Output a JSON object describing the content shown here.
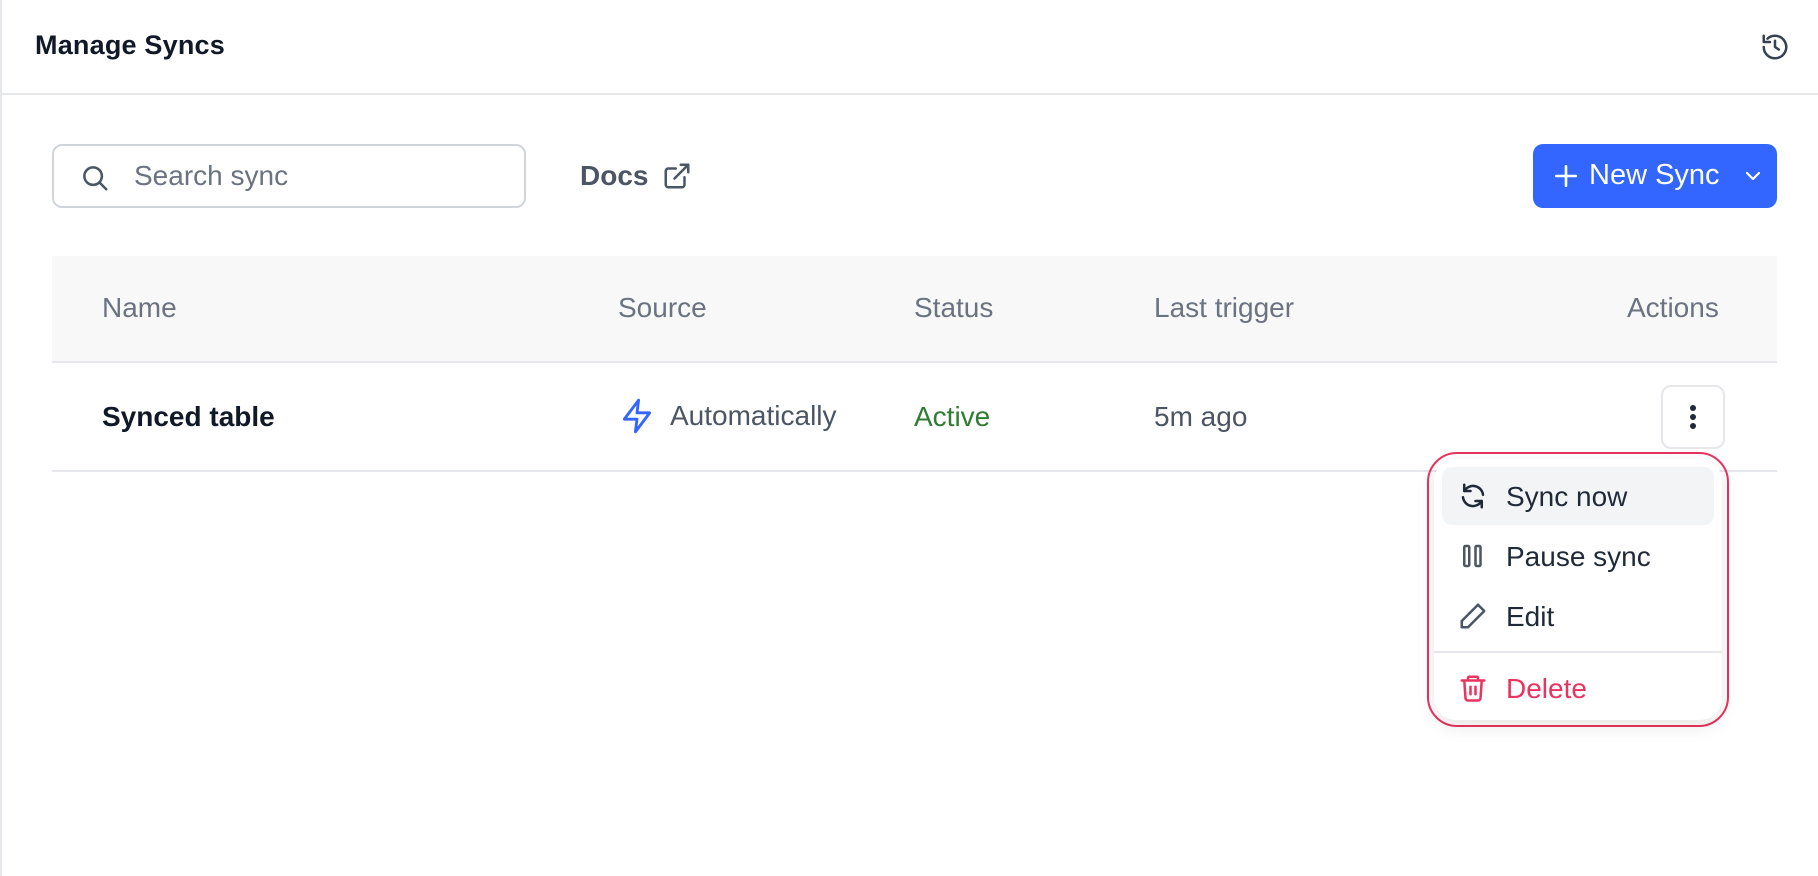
{
  "header": {
    "title": "Manage Syncs",
    "history_icon": "history-icon"
  },
  "toolbar": {
    "search_placeholder": "Search sync",
    "search_value": "",
    "docs_label": "Docs",
    "new_sync_label": "New Sync"
  },
  "table": {
    "columns": [
      "Name",
      "Source",
      "Status",
      "Last trigger",
      "Actions"
    ],
    "rows": [
      {
        "name": "Synced table",
        "source": "Automatically",
        "source_icon": "lightning-icon",
        "status": "Active",
        "last_trigger": "5m ago"
      }
    ]
  },
  "action_menu": {
    "items": [
      {
        "label": "Sync now",
        "icon": "refresh-icon",
        "active": true
      },
      {
        "label": "Pause sync",
        "icon": "pause-icon"
      },
      {
        "label": "Edit",
        "icon": "pencil-icon"
      },
      {
        "label": "Delete",
        "icon": "trash-icon",
        "danger": true
      }
    ]
  },
  "colors": {
    "primary": "#3366ff",
    "status_active": "#2e7d32",
    "danger": "#e8345e",
    "source_icon": "#3366ff"
  }
}
